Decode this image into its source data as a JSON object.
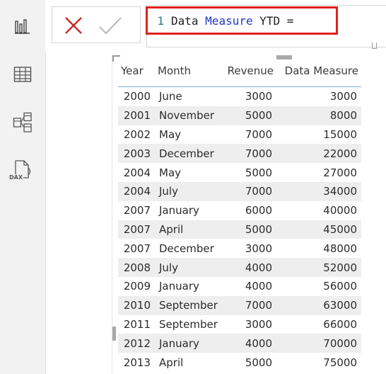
{
  "formula_bar": {
    "line_number": "1",
    "formula_name_part1": "Data ",
    "formula_measure_word": "Measure",
    "formula_rest": " YTD ="
  },
  "nav": {
    "icons": [
      "report-view-icon",
      "data-view-icon",
      "model-view-icon",
      "dax-query-view-icon"
    ],
    "dax_label": "DAX"
  },
  "table": {
    "columns": [
      "Year",
      "Month",
      "Revenue",
      "Data Measure"
    ],
    "rows": [
      [
        "2000",
        "June",
        "3000",
        "3000"
      ],
      [
        "2001",
        "November",
        "5000",
        "8000"
      ],
      [
        "2002",
        "May",
        "7000",
        "15000"
      ],
      [
        "2003",
        "December",
        "7000",
        "22000"
      ],
      [
        "2004",
        "May",
        "5000",
        "27000"
      ],
      [
        "2004",
        "July",
        "7000",
        "34000"
      ],
      [
        "2007",
        "January",
        "6000",
        "40000"
      ],
      [
        "2007",
        "April",
        "5000",
        "45000"
      ],
      [
        "2007",
        "December",
        "3000",
        "48000"
      ],
      [
        "2008",
        "July",
        "4000",
        "52000"
      ],
      [
        "2009",
        "January",
        "4000",
        "56000"
      ],
      [
        "2010",
        "September",
        "7000",
        "63000"
      ],
      [
        "2011",
        "September",
        "3000",
        "66000"
      ],
      [
        "2012",
        "January",
        "4000",
        "70000"
      ],
      [
        "2013",
        "April",
        "5000",
        "75000"
      ]
    ]
  },
  "colors": {
    "highlight": "#e0201b",
    "cancel": "#c62828",
    "measure_keyword": "#1f37c7",
    "header_underline": "#7fb2d4",
    "alt_row": "#eeeeee"
  }
}
